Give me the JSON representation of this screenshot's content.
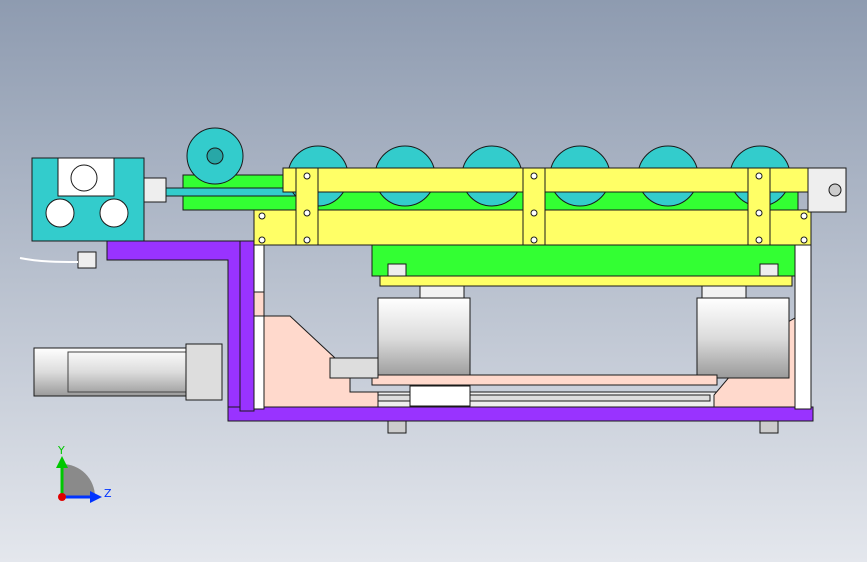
{
  "viewport": {
    "background_top": "#8e9bb0",
    "background_bottom": "#e4e7ed"
  },
  "colors": {
    "yellow": "#ffff66",
    "green": "#33ff33",
    "purple": "#9933ff",
    "cyan": "#33cccc",
    "peach": "#ffd9cc",
    "white": "#ffffff",
    "outline": "#1a1a1a"
  },
  "triad": {
    "y_label": "Y",
    "z_label": "Z",
    "y_color": "#00c800",
    "z_color": "#0033ff",
    "origin_color": "#e00000"
  }
}
